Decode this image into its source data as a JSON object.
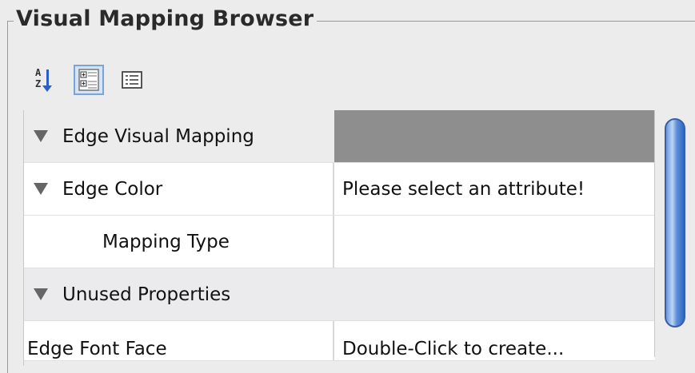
{
  "panel": {
    "title": "Visual Mapping Browser"
  },
  "toolbar": {
    "sort_label": "A Z",
    "buttons": [
      "sort-alphabetical",
      "categorized-view",
      "list-view"
    ]
  },
  "table": {
    "rows": [
      {
        "name": "Edge Visual Mapping",
        "value": "",
        "type": "category",
        "expanded": true
      },
      {
        "name": "Edge Color",
        "value": "Please select an attribute!",
        "type": "property",
        "expanded": true
      },
      {
        "name": "Mapping Type",
        "value": "",
        "type": "sub-property"
      },
      {
        "name": "Unused Properties",
        "value": "",
        "type": "category",
        "expanded": true
      },
      {
        "name": "Edge Font Face",
        "value": "Double-Click to create...",
        "type": "property"
      }
    ]
  },
  "colors": {
    "header_bg": "#8e8e8e",
    "scroll_thumb": "#5f8fd7",
    "selected_button": "#d4e3f5"
  }
}
